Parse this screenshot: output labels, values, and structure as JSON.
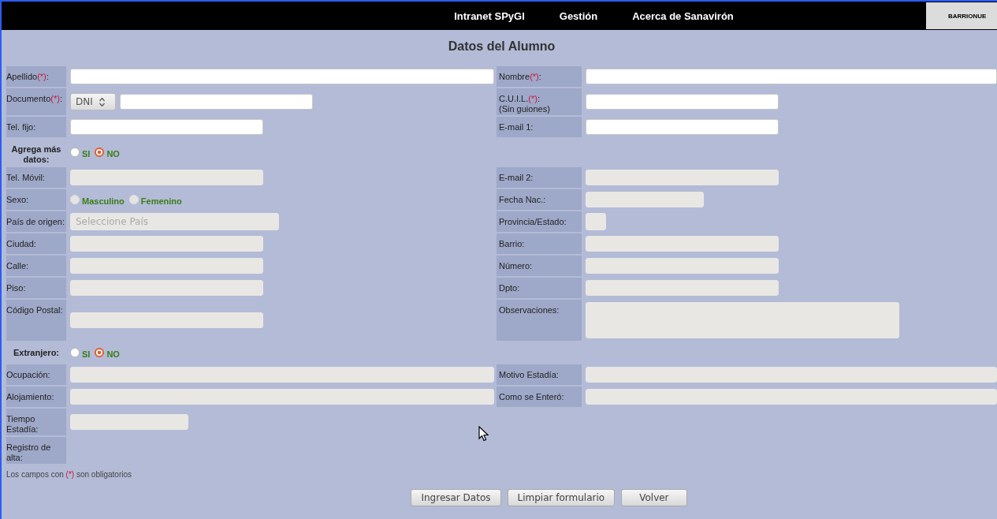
{
  "nav": {
    "items": [
      {
        "label": "Intranet SPyGI"
      },
      {
        "label": "Gestión"
      },
      {
        "label": "Acerca de Sanavirón"
      }
    ],
    "user": "BARRIONUE"
  },
  "title": "Datos del Alumno",
  "rows": [
    {
      "left": {
        "label": "Apellido",
        "mark": "(*)",
        "after": ":",
        "kind": "text-long",
        "disabled": false
      },
      "right": {
        "label": "Nombre",
        "mark": "(*)",
        "after": ":",
        "kind": "text-long",
        "disabled": false
      }
    },
    {
      "left": {
        "label": "Documento",
        "mark": "(*)",
        "after": ":",
        "kind": "doc",
        "value": "DNI",
        "disabled": false
      },
      "right": {
        "label": "C.U.I.L.",
        "mark": "(*)",
        "after": ":",
        "note": "(Sin guiones)",
        "kind": "text",
        "disabled": false
      }
    },
    {
      "left": {
        "label": "Tel. fijo:",
        "kind": "text",
        "disabled": false
      },
      "right": {
        "label": "E-mail 1:",
        "kind": "text",
        "disabled": false
      }
    },
    {
      "left": {
        "label": "Agrega más datos:",
        "bold": true,
        "kind": "radio",
        "disabled": false,
        "options": [
          {
            "label": "SI",
            "selected": false
          },
          {
            "label": "NO",
            "selected": true
          }
        ]
      }
    },
    {
      "left": {
        "label": "Tel. Móvil:",
        "kind": "text",
        "disabled": true
      },
      "right": {
        "label": "E-mail 2:",
        "kind": "text",
        "disabled": true
      }
    },
    {
      "left": {
        "label": "Sexo:",
        "kind": "radio",
        "disabled": true,
        "options": [
          {
            "label": "Masculino",
            "selected": false
          },
          {
            "label": "Femenino",
            "selected": false
          }
        ]
      },
      "right": {
        "label": "Fecha Nac.:",
        "kind": "text-short",
        "disabled": true
      }
    },
    {
      "left": {
        "label": "País de origen:",
        "kind": "select",
        "value": "Seleccione País",
        "disabled": true
      },
      "right": {
        "label": "Provincia/Estado:",
        "kind": "select-mini",
        "disabled": true
      }
    },
    {
      "left": {
        "label": "Ciudad:",
        "kind": "text",
        "disabled": true
      },
      "right": {
        "label": "Barrio:",
        "kind": "text",
        "disabled": true
      }
    },
    {
      "left": {
        "label": "Calle:",
        "kind": "text",
        "disabled": true
      },
      "right": {
        "label": "Número:",
        "kind": "text",
        "disabled": true
      }
    },
    {
      "left": {
        "label": "Piso:",
        "kind": "text",
        "disabled": true
      },
      "right": {
        "label": "Dpto:",
        "kind": "text",
        "disabled": true
      }
    },
    {
      "left": {
        "label": "Código Postal:",
        "kind": "text",
        "disabled": true
      },
      "right": {
        "label": "Observaciones:",
        "kind": "textarea",
        "disabled": true
      }
    },
    {
      "left": {
        "label": "Extranjero:",
        "bold": true,
        "kind": "radio",
        "disabled": false,
        "options": [
          {
            "label": "SI",
            "selected": false
          },
          {
            "label": "NO",
            "selected": true
          }
        ]
      }
    },
    {
      "left": {
        "label": "Ocupación:",
        "kind": "text-long",
        "disabled": true
      },
      "right": {
        "label": "Motivo Estadía:",
        "kind": "text-long",
        "disabled": true
      }
    },
    {
      "left": {
        "label": "Alojamiento:",
        "kind": "text-long",
        "disabled": true
      },
      "right": {
        "label": "Como se Enteró:",
        "kind": "text-long",
        "disabled": true
      }
    },
    {
      "left": {
        "label": "Tiempo Estadía:",
        "kind": "text-short",
        "disabled": true
      }
    },
    {
      "left": {
        "label": "Registro de alta:",
        "kind": "none"
      }
    }
  ],
  "note": {
    "before": "Los campos con",
    "mark": "(*)",
    "after": "son obligatorios"
  },
  "buttons": [
    {
      "label": "Ingresar Datos"
    },
    {
      "label": "Limpiar formulario"
    },
    {
      "label": "Volver"
    }
  ]
}
